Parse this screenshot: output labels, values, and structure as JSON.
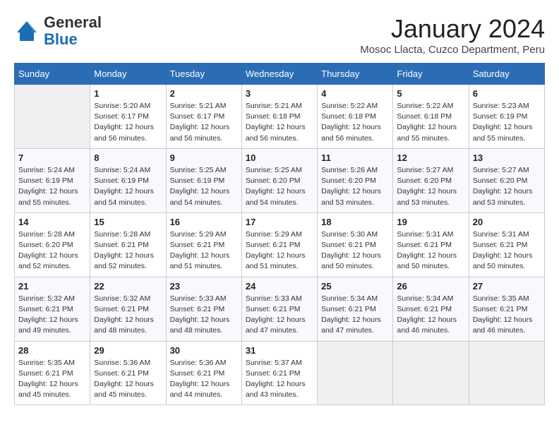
{
  "header": {
    "logo_line1": "General",
    "logo_line2": "Blue",
    "month_title": "January 2024",
    "subtitle": "Mosoc Llacta, Cuzco Department, Peru"
  },
  "weekdays": [
    "Sunday",
    "Monday",
    "Tuesday",
    "Wednesday",
    "Thursday",
    "Friday",
    "Saturday"
  ],
  "weeks": [
    [
      {
        "day": "",
        "info": ""
      },
      {
        "day": "1",
        "info": "Sunrise: 5:20 AM\nSunset: 6:17 PM\nDaylight: 12 hours\nand 56 minutes."
      },
      {
        "day": "2",
        "info": "Sunrise: 5:21 AM\nSunset: 6:17 PM\nDaylight: 12 hours\nand 56 minutes."
      },
      {
        "day": "3",
        "info": "Sunrise: 5:21 AM\nSunset: 6:18 PM\nDaylight: 12 hours\nand 56 minutes."
      },
      {
        "day": "4",
        "info": "Sunrise: 5:22 AM\nSunset: 6:18 PM\nDaylight: 12 hours\nand 56 minutes."
      },
      {
        "day": "5",
        "info": "Sunrise: 5:22 AM\nSunset: 6:18 PM\nDaylight: 12 hours\nand 55 minutes."
      },
      {
        "day": "6",
        "info": "Sunrise: 5:23 AM\nSunset: 6:19 PM\nDaylight: 12 hours\nand 55 minutes."
      }
    ],
    [
      {
        "day": "7",
        "info": "Sunrise: 5:24 AM\nSunset: 6:19 PM\nDaylight: 12 hours\nand 55 minutes."
      },
      {
        "day": "8",
        "info": "Sunrise: 5:24 AM\nSunset: 6:19 PM\nDaylight: 12 hours\nand 54 minutes."
      },
      {
        "day": "9",
        "info": "Sunrise: 5:25 AM\nSunset: 6:19 PM\nDaylight: 12 hours\nand 54 minutes."
      },
      {
        "day": "10",
        "info": "Sunrise: 5:25 AM\nSunset: 6:20 PM\nDaylight: 12 hours\nand 54 minutes."
      },
      {
        "day": "11",
        "info": "Sunrise: 5:26 AM\nSunset: 6:20 PM\nDaylight: 12 hours\nand 53 minutes."
      },
      {
        "day": "12",
        "info": "Sunrise: 5:27 AM\nSunset: 6:20 PM\nDaylight: 12 hours\nand 53 minutes."
      },
      {
        "day": "13",
        "info": "Sunrise: 5:27 AM\nSunset: 6:20 PM\nDaylight: 12 hours\nand 53 minutes."
      }
    ],
    [
      {
        "day": "14",
        "info": "Sunrise: 5:28 AM\nSunset: 6:20 PM\nDaylight: 12 hours\nand 52 minutes."
      },
      {
        "day": "15",
        "info": "Sunrise: 5:28 AM\nSunset: 6:21 PM\nDaylight: 12 hours\nand 52 minutes."
      },
      {
        "day": "16",
        "info": "Sunrise: 5:29 AM\nSunset: 6:21 PM\nDaylight: 12 hours\nand 51 minutes."
      },
      {
        "day": "17",
        "info": "Sunrise: 5:29 AM\nSunset: 6:21 PM\nDaylight: 12 hours\nand 51 minutes."
      },
      {
        "day": "18",
        "info": "Sunrise: 5:30 AM\nSunset: 6:21 PM\nDaylight: 12 hours\nand 50 minutes."
      },
      {
        "day": "19",
        "info": "Sunrise: 5:31 AM\nSunset: 6:21 PM\nDaylight: 12 hours\nand 50 minutes."
      },
      {
        "day": "20",
        "info": "Sunrise: 5:31 AM\nSunset: 6:21 PM\nDaylight: 12 hours\nand 50 minutes."
      }
    ],
    [
      {
        "day": "21",
        "info": "Sunrise: 5:32 AM\nSunset: 6:21 PM\nDaylight: 12 hours\nand 49 minutes."
      },
      {
        "day": "22",
        "info": "Sunrise: 5:32 AM\nSunset: 6:21 PM\nDaylight: 12 hours\nand 48 minutes."
      },
      {
        "day": "23",
        "info": "Sunrise: 5:33 AM\nSunset: 6:21 PM\nDaylight: 12 hours\nand 48 minutes."
      },
      {
        "day": "24",
        "info": "Sunrise: 5:33 AM\nSunset: 6:21 PM\nDaylight: 12 hours\nand 47 minutes."
      },
      {
        "day": "25",
        "info": "Sunrise: 5:34 AM\nSunset: 6:21 PM\nDaylight: 12 hours\nand 47 minutes."
      },
      {
        "day": "26",
        "info": "Sunrise: 5:34 AM\nSunset: 6:21 PM\nDaylight: 12 hours\nand 46 minutes."
      },
      {
        "day": "27",
        "info": "Sunrise: 5:35 AM\nSunset: 6:21 PM\nDaylight: 12 hours\nand 46 minutes."
      }
    ],
    [
      {
        "day": "28",
        "info": "Sunrise: 5:35 AM\nSunset: 6:21 PM\nDaylight: 12 hours\nand 45 minutes."
      },
      {
        "day": "29",
        "info": "Sunrise: 5:36 AM\nSunset: 6:21 PM\nDaylight: 12 hours\nand 45 minutes."
      },
      {
        "day": "30",
        "info": "Sunrise: 5:36 AM\nSunset: 6:21 PM\nDaylight: 12 hours\nand 44 minutes."
      },
      {
        "day": "31",
        "info": "Sunrise: 5:37 AM\nSunset: 6:21 PM\nDaylight: 12 hours\nand 43 minutes."
      },
      {
        "day": "",
        "info": ""
      },
      {
        "day": "",
        "info": ""
      },
      {
        "day": "",
        "info": ""
      }
    ]
  ]
}
